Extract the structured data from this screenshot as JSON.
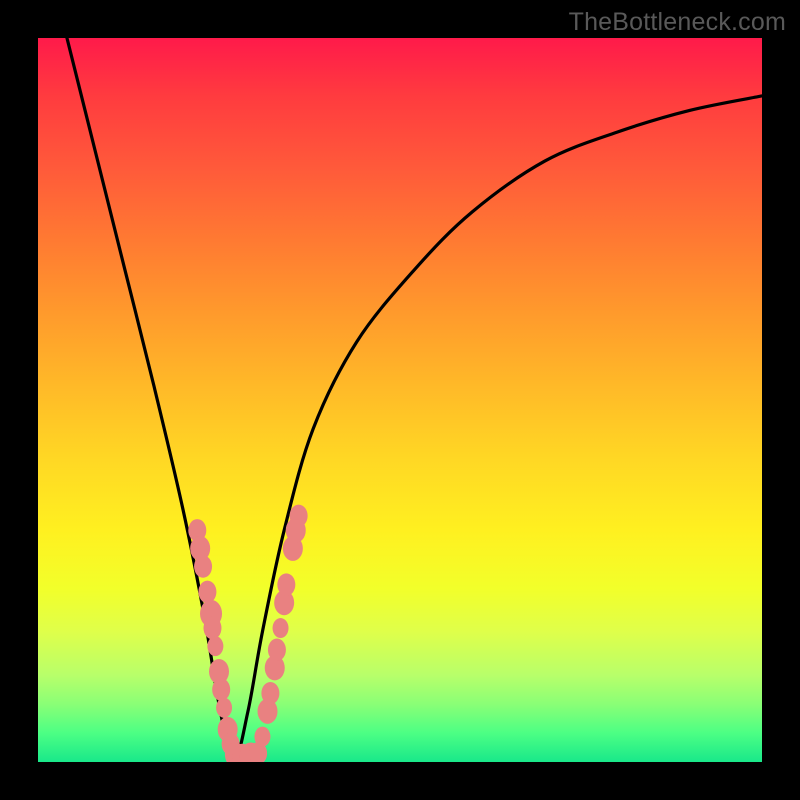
{
  "watermark": "TheBottleneck.com",
  "colors": {
    "frame": "#000000",
    "curve": "#000000",
    "marker_fill": "#e98181",
    "marker_stroke": "#c96a6a"
  },
  "chart_data": {
    "type": "line",
    "title": "",
    "xlabel": "",
    "ylabel": "",
    "xlim": [
      0,
      100
    ],
    "ylim": [
      0,
      100
    ],
    "note": "Qualitative bottleneck-style V curve. Vertical axis: mismatch (0=green/good near bottom, 100=red/bad at top). Minimum near x≈27. Values estimated from the rendered curve; no axis ticks shown.",
    "series": [
      {
        "name": "curve",
        "x": [
          4,
          8,
          12,
          16,
          20,
          23,
          25,
          27,
          29,
          31,
          34,
          38,
          44,
          52,
          60,
          70,
          80,
          90,
          100
        ],
        "y": [
          100,
          84,
          68,
          52,
          35,
          20,
          8,
          0,
          7,
          18,
          32,
          46,
          58,
          68,
          76,
          83,
          87,
          90,
          92
        ]
      }
    ],
    "markers": {
      "comment": "Salmon bead clusters along the V near the bottom. Positions in percent of plot area (0,0 bottom-left).",
      "points": [
        {
          "x": 22.0,
          "y": 32.0,
          "r": 9
        },
        {
          "x": 22.4,
          "y": 29.5,
          "r": 10
        },
        {
          "x": 22.8,
          "y": 27.0,
          "r": 9
        },
        {
          "x": 23.4,
          "y": 23.5,
          "r": 9
        },
        {
          "x": 23.9,
          "y": 20.5,
          "r": 11
        },
        {
          "x": 24.1,
          "y": 18.5,
          "r": 9
        },
        {
          "x": 24.5,
          "y": 16.0,
          "r": 8
        },
        {
          "x": 25.0,
          "y": 12.5,
          "r": 10
        },
        {
          "x": 25.3,
          "y": 10.0,
          "r": 9
        },
        {
          "x": 25.7,
          "y": 7.5,
          "r": 8
        },
        {
          "x": 26.2,
          "y": 4.5,
          "r": 10
        },
        {
          "x": 26.6,
          "y": 2.5,
          "r": 9
        },
        {
          "x": 27.2,
          "y": 1.0,
          "r": 10
        },
        {
          "x": 28.2,
          "y": 0.8,
          "r": 10
        },
        {
          "x": 29.4,
          "y": 0.8,
          "r": 11
        },
        {
          "x": 30.4,
          "y": 1.2,
          "r": 9
        },
        {
          "x": 31.0,
          "y": 3.5,
          "r": 8
        },
        {
          "x": 31.7,
          "y": 7.0,
          "r": 10
        },
        {
          "x": 32.1,
          "y": 9.5,
          "r": 9
        },
        {
          "x": 32.7,
          "y": 13.0,
          "r": 10
        },
        {
          "x": 33.0,
          "y": 15.5,
          "r": 9
        },
        {
          "x": 33.5,
          "y": 18.5,
          "r": 8
        },
        {
          "x": 34.0,
          "y": 22.0,
          "r": 10
        },
        {
          "x": 34.3,
          "y": 24.5,
          "r": 9
        },
        {
          "x": 35.2,
          "y": 29.5,
          "r": 10
        },
        {
          "x": 35.6,
          "y": 32.0,
          "r": 10
        },
        {
          "x": 36.0,
          "y": 34.0,
          "r": 9
        }
      ]
    }
  }
}
